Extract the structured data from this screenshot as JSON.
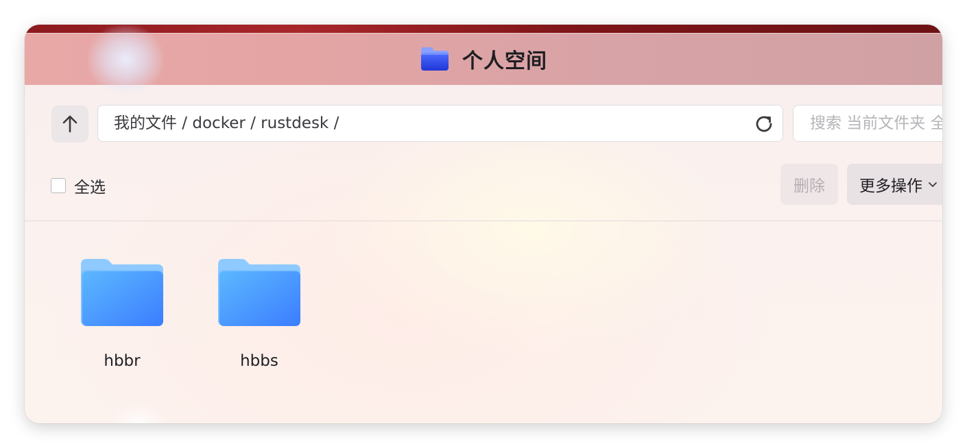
{
  "window": {
    "title": "个人空间",
    "title_icon": "folder-icon"
  },
  "toolbar": {
    "up_icon": "arrow-up-icon",
    "path": "我的文件 / docker / rustdesk /",
    "refresh_icon": "refresh-icon",
    "search_placeholder": "搜索 当前文件夹 全部"
  },
  "actions": {
    "select_all_label": "全选",
    "delete_label": "删除",
    "more_label": "更多操作",
    "more_icon": "chevron-down-icon"
  },
  "files": [
    {
      "name": "hbbr",
      "type": "folder"
    },
    {
      "name": "hbbs",
      "type": "folder"
    }
  ],
  "colors": {
    "folder_blue": "#4a9dff",
    "title_icon_blue": "#2d4fe0",
    "titlebar": "#e0a4a5"
  }
}
